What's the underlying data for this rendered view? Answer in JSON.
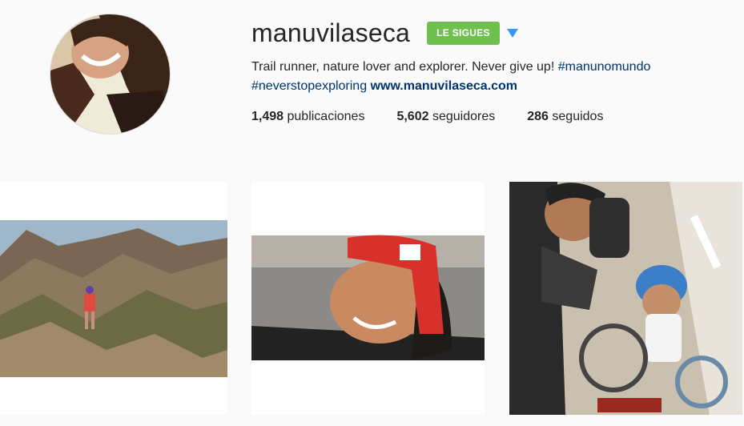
{
  "profile": {
    "username": "manuvilaseca",
    "follow_label": "LE SIGUES",
    "bio_text": "Trail runner, nature lover and explorer. Never give up! ",
    "bio_tag1": "#manunomundo",
    "bio_tag2": "#neverstopexploring",
    "bio_link": "www.manuvilaseca.com"
  },
  "stats": [
    {
      "count": "1,498",
      "label": "publicaciones"
    },
    {
      "count": "5,602",
      "label": "seguidores"
    },
    {
      "count": "286",
      "label": "seguidos"
    }
  ],
  "colors": {
    "follow_button": "#70c050",
    "link": "#003569",
    "dropdown_arrow": "#3897f0"
  }
}
